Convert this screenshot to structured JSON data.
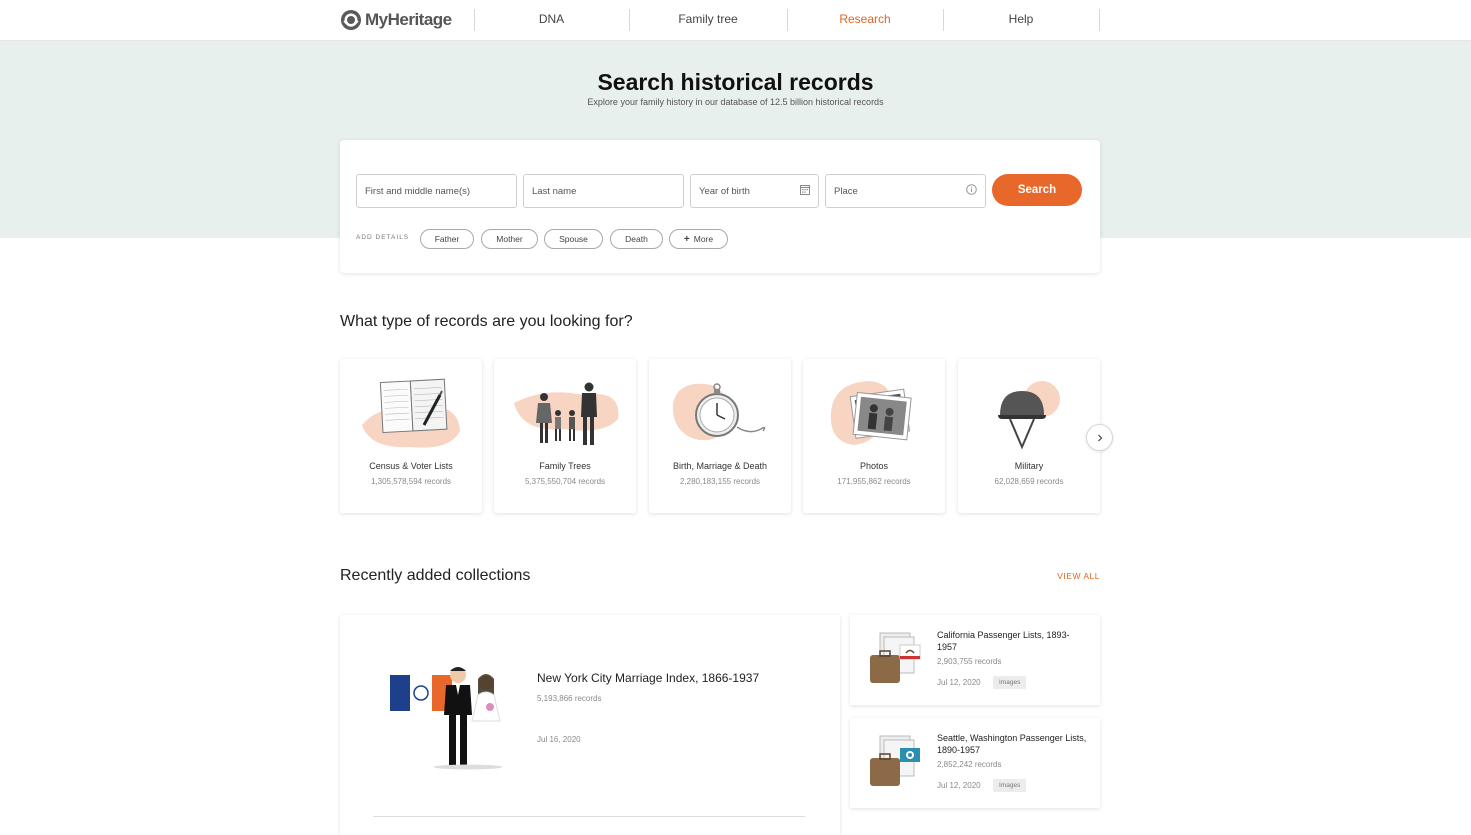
{
  "brand": {
    "name": "MyHeritage"
  },
  "nav": {
    "items": [
      {
        "label": "DNA",
        "active": false
      },
      {
        "label": "Family tree",
        "active": false
      },
      {
        "label": "Research",
        "active": true
      },
      {
        "label": "Help",
        "active": false
      }
    ]
  },
  "hero": {
    "title": "Search historical records",
    "subtitle": "Explore your family history in our database of 12.5 billion historical records"
  },
  "search": {
    "first_name_placeholder": "First and middle name(s)",
    "last_name_placeholder": "Last name",
    "year_placeholder": "Year of birth",
    "place_placeholder": "Place",
    "button_label": "Search",
    "add_details_label": "ADD DETAILS",
    "chips": [
      "Father",
      "Mother",
      "Spouse",
      "Death",
      "More"
    ]
  },
  "record_types": {
    "title": "What type of records are you looking for?",
    "items": [
      {
        "label": "Census & Voter Lists",
        "count": "1,305,578,594 records",
        "icon": "census-book-icon"
      },
      {
        "label": "Family Trees",
        "count": "5,375,550,704 records",
        "icon": "family-icon"
      },
      {
        "label": "Birth, Marriage & Death",
        "count": "2,280,183,155 records",
        "icon": "pocket-watch-icon"
      },
      {
        "label": "Photos",
        "count": "171,955,862 records",
        "icon": "photos-icon"
      },
      {
        "label": "Military",
        "count": "62,028,659 records",
        "icon": "helmet-icon"
      }
    ]
  },
  "collections": {
    "title": "Recently added collections",
    "view_all": "VIEW ALL",
    "featured": {
      "name": "New York City Marriage Index, 1866-1937",
      "count": "5,193,866 records",
      "date": "Jul 16, 2020"
    },
    "items": [
      {
        "name": "California Passenger Lists, 1893-1957",
        "count": "2,903,755 records",
        "date": "Jul 12, 2020",
        "badge": "Images"
      },
      {
        "name": "Seattle, Washington Passenger Lists, 1890-1957",
        "count": "2,852,242 records",
        "date": "Jul 12, 2020",
        "badge": "Images"
      }
    ]
  },
  "colors": {
    "accent": "#e8672a",
    "hero_bg": "#e8f0ed",
    "peach": "#f6c9b3"
  }
}
